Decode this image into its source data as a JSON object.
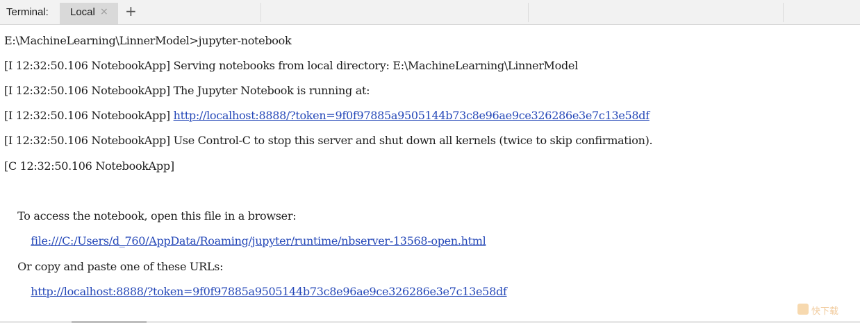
{
  "tabbar": {
    "label": "Terminal:",
    "tabs": [
      {
        "label": "Local",
        "close_glyph": "×",
        "active": true
      }
    ],
    "add_glyph": "+"
  },
  "terminal": {
    "lines": [
      {
        "text": "E:\\MachineLearning\\LinnerModel>jupyter-notebook"
      },
      {
        "text": "[I 12:32:50.106 NotebookApp] Serving notebooks from local directory: E:\\MachineLearning\\LinnerModel"
      },
      {
        "text": "[I 12:32:50.106 NotebookApp] The Jupyter Notebook is running at:"
      },
      {
        "prefix": "[I 12:32:50.106 NotebookApp] ",
        "link": "http://localhost:8888/?token=9f0f97885a9505144b73c8e96ae9ce326286e3e7c13e58df"
      },
      {
        "text": "[I 12:32:50.106 NotebookApp] Use Control-C to stop this server and shut down all kernels (twice to skip confirmation)."
      },
      {
        "text": "[C 12:32:50.106 NotebookApp]"
      },
      {
        "text": ""
      },
      {
        "text": "    To access the notebook, open this file in a browser:"
      },
      {
        "indent": "        ",
        "link": "file:///C:/Users/d_760/AppData/Roaming/jupyter/runtime/nbserver-13568-open.html"
      },
      {
        "text": "    Or copy and paste one of these URLs:"
      },
      {
        "indent": "        ",
        "link": "http://localhost:8888/?token=9f0f97885a9505144b73c8e96ae9ce326286e3e7c13e58df"
      }
    ]
  },
  "watermark": {
    "text": "快下载"
  },
  "colors": {
    "link": "#2548b8",
    "text": "#1e1e1e",
    "tab_active_bg": "#d9d9d9",
    "tabbar_bg": "#f2f2f2"
  }
}
